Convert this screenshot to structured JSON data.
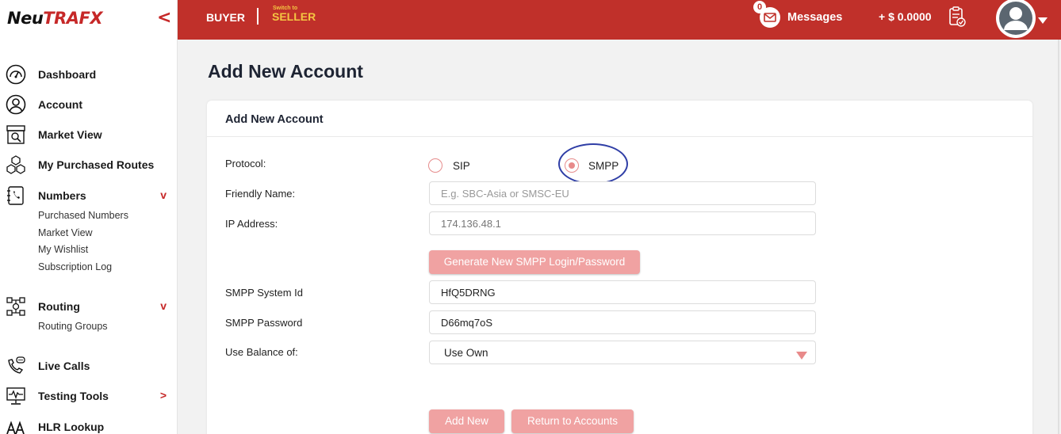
{
  "brand": {
    "part1": "Neu",
    "part2": "TRAF",
    "part3": "X"
  },
  "sidebar": {
    "collapse_label": "<",
    "items": [
      {
        "label": "Dashboard"
      },
      {
        "label": "Account"
      },
      {
        "label": "Market View"
      },
      {
        "label": "My Purchased Routes"
      },
      {
        "label": "Numbers",
        "arrow": "v"
      },
      {
        "label": "Routing",
        "arrow": "v"
      },
      {
        "label": "Live Calls"
      },
      {
        "label": "Testing Tools",
        "arrow": ">"
      },
      {
        "label": "HLR Lookup"
      }
    ],
    "numbers_sub": [
      "Purchased Numbers",
      "Market View",
      "My Wishlist",
      "Subscription Log"
    ],
    "routing_sub": [
      "Routing Groups"
    ]
  },
  "topbar": {
    "buyer": "BUYER",
    "switch_to": "Switch to",
    "seller": "SELLER",
    "messages_count": "0",
    "messages_label": "Messages",
    "balance": "+ $ 0.0000"
  },
  "page": {
    "title": "Add New Account"
  },
  "form": {
    "card_title": "Add New Account",
    "protocol_label": "Protocol:",
    "protocol_options": [
      "SIP",
      "SMPP"
    ],
    "protocol_selected": "SMPP",
    "friendly_name_label": "Friendly Name:",
    "friendly_name_placeholder": "E.g. SBC-Asia or SMSC-EU",
    "ip_label": "IP Address:",
    "ip_value": "174.136.48.1",
    "generate_button": "Generate New SMPP Login/Password",
    "system_id_label": "SMPP System Id",
    "system_id_value": "HfQ5DRNG",
    "password_label": "SMPP Password",
    "password_value": "D66mq7oS",
    "balance_label": "Use Balance of:",
    "balance_value": "Use Own",
    "add_button": "Add New",
    "return_button": "Return to Accounts"
  },
  "colors": {
    "brand_red": "#c0302a",
    "seller_yellow": "#f4c542",
    "button_pink": "#f0a2a2",
    "annotation_blue": "#2f3ea6"
  }
}
